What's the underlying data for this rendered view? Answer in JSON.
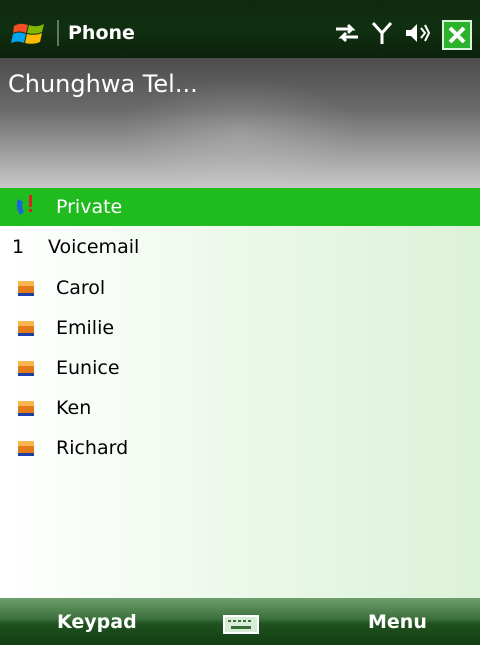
{
  "status_bar": {
    "title": "Phone",
    "icons": [
      "start-menu-icon",
      "data-connection-icon",
      "signal-icon",
      "speaker-icon",
      "close-icon"
    ]
  },
  "banner": {
    "carrier": "Chunghwa Tel..."
  },
  "list": {
    "items": [
      {
        "icon": "missed-call-icon",
        "label": "Private",
        "selected": true
      },
      {
        "number": "1",
        "label": "Voicemail"
      },
      {
        "icon": "contact-card-icon",
        "label": "Carol"
      },
      {
        "icon": "contact-card-icon",
        "label": "Emilie"
      },
      {
        "icon": "contact-card-icon",
        "label": "Eunice"
      },
      {
        "icon": "contact-card-icon",
        "label": "Ken"
      },
      {
        "icon": "contact-card-icon",
        "label": "Richard"
      }
    ]
  },
  "softkeys": {
    "left": "Keypad",
    "center_icon": "keyboard-icon",
    "right": "Menu"
  },
  "colors": {
    "selection": "#1fbb1f",
    "topbar": "#0f2a0f",
    "close_button": "#2cb22c"
  }
}
